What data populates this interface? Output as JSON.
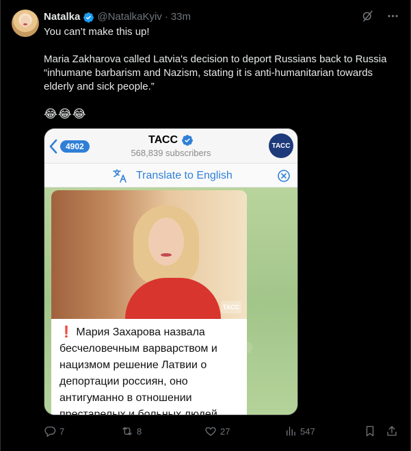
{
  "author": {
    "display_name": "Natalka",
    "handle": "@NatalkaKyiv",
    "separator": "·",
    "time": "33m"
  },
  "tweet_text": {
    "line1": "You can’t make this up!",
    "line2": "Maria Zakharova called Latvia's decision to deport Russians back to Russia “inhumane barbarism and Nazism, stating it is anti-humanitarian towards elderly and sick people.”",
    "emojis": "😂😂😂"
  },
  "embedded": {
    "back_count": "4902",
    "channel_name": "ТАСС",
    "subscribers": "568,839 subscribers",
    "logo_text": "ТАСС",
    "translate_label": "Translate to English",
    "photo_watermark": "ТАСС",
    "message_excl": "❗",
    "message": "Мария Захарова назвала бесчеловечным варварством и нацизмом решение Латвии о депортации россиян, оно антигуманно в отношении престарелых и больных людей."
  },
  "actions": {
    "replies": "7",
    "retweets": "8",
    "likes": "27",
    "views": "547"
  },
  "colors": {
    "background": "#000000",
    "text": "#e7e9ea",
    "muted": "#71767b",
    "verified": "#1d9bf0",
    "telegram_blue": "#2f7fd6"
  }
}
